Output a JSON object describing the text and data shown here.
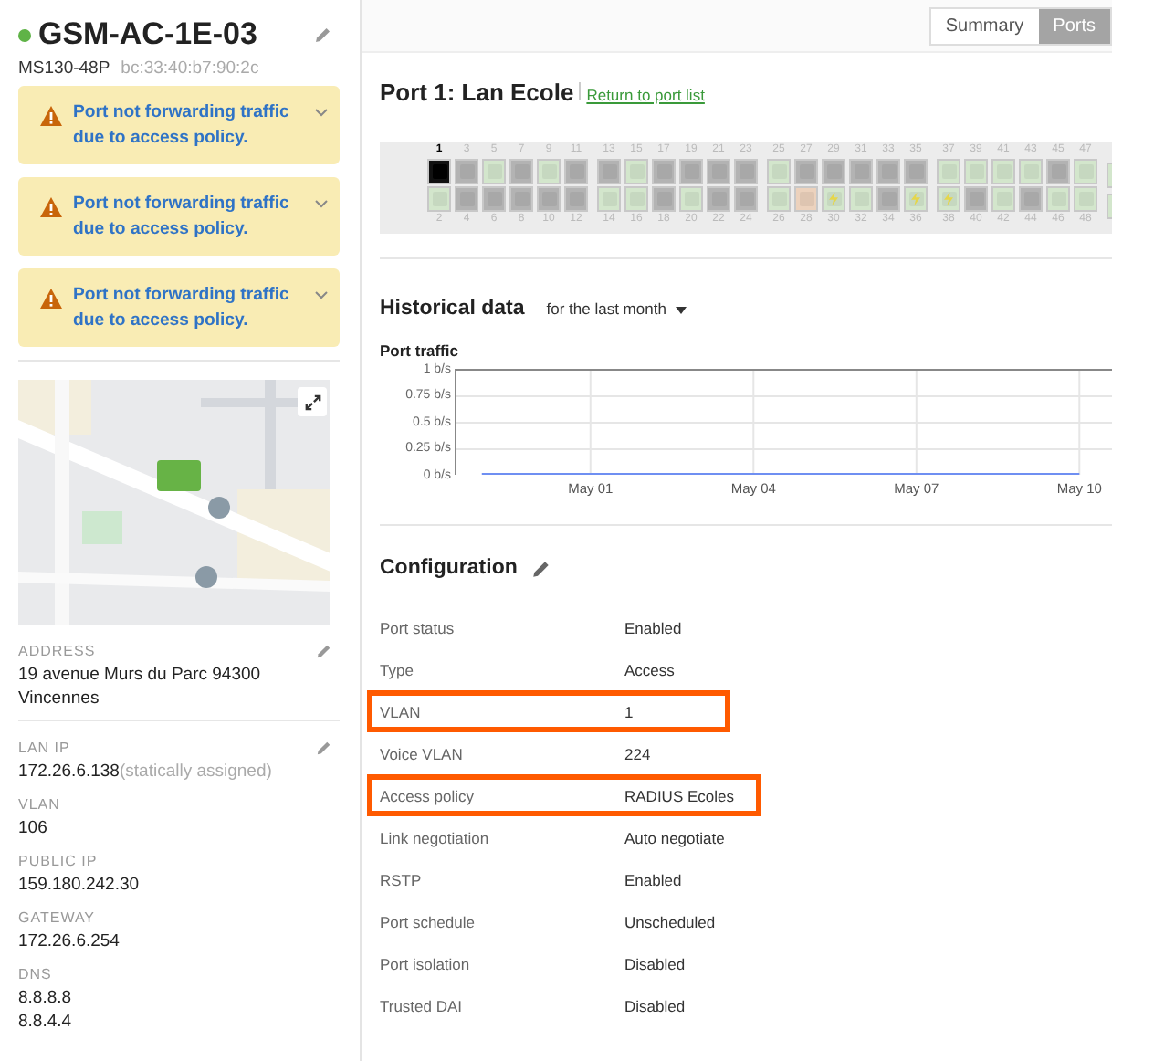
{
  "device": {
    "name": "GSM-AC-1E-03",
    "online": true,
    "model": "MS130-48P",
    "mac": "bc:33:40:b7:90:2c"
  },
  "alerts": [
    {
      "text": "Port not forwarding traffic due to access policy."
    },
    {
      "text": "Port not forwarding traffic due to access policy."
    },
    {
      "text": "Port not forwarding traffic due to access policy."
    }
  ],
  "address": {
    "label": "ADDRESS",
    "value": "19 avenue Murs du Parc 94300 Vincennes"
  },
  "details": [
    {
      "label": "LAN IP",
      "values": [
        "172.26.6.138"
      ],
      "note": "(statically assigned)",
      "editable": true
    },
    {
      "label": "VLAN",
      "values": [
        "106"
      ],
      "editable": false
    },
    {
      "label": "PUBLIC IP",
      "values": [
        "159.180.242.30"
      ],
      "editable": false
    },
    {
      "label": "GATEWAY",
      "values": [
        "172.26.6.254"
      ],
      "editable": false
    },
    {
      "label": "DNS",
      "values": [
        "8.8.8.8",
        "8.8.4.4"
      ],
      "editable": false
    }
  ],
  "tabs": [
    {
      "label": "Summary",
      "selected": false
    },
    {
      "label": "Ports",
      "selected": true
    }
  ],
  "port_title": "Port 1: Lan Ecole",
  "return_link": "Return to port list",
  "ports": [
    {
      "number": "1",
      "kind": "selected",
      "poe": false
    },
    {
      "number": "2",
      "kind": "connected",
      "poe": false
    },
    {
      "number": "3",
      "kind": "disconnected",
      "poe": false
    },
    {
      "number": "4",
      "kind": "disconnected",
      "poe": false
    },
    {
      "number": "5",
      "kind": "connected",
      "poe": false
    },
    {
      "number": "6",
      "kind": "disconnected",
      "poe": false
    },
    {
      "number": "7",
      "kind": "disconnected",
      "poe": false
    },
    {
      "number": "8",
      "kind": "disconnected",
      "poe": false
    },
    {
      "number": "9",
      "kind": "connected",
      "poe": false
    },
    {
      "number": "10",
      "kind": "disconnected",
      "poe": false
    },
    {
      "number": "11",
      "kind": "disconnected",
      "poe": false
    },
    {
      "number": "12",
      "kind": "disconnected",
      "poe": false
    },
    {
      "number": "13",
      "kind": "disconnected",
      "poe": false
    },
    {
      "number": "14",
      "kind": "connected",
      "poe": false
    },
    {
      "number": "15",
      "kind": "connected",
      "poe": false
    },
    {
      "number": "16",
      "kind": "connected",
      "poe": false
    },
    {
      "number": "17",
      "kind": "disconnected",
      "poe": false
    },
    {
      "number": "18",
      "kind": "disconnected",
      "poe": false
    },
    {
      "number": "19",
      "kind": "disconnected",
      "poe": false
    },
    {
      "number": "20",
      "kind": "connected",
      "poe": false
    },
    {
      "number": "21",
      "kind": "disconnected",
      "poe": false
    },
    {
      "number": "22",
      "kind": "disconnected",
      "poe": false
    },
    {
      "number": "23",
      "kind": "disconnected",
      "poe": false
    },
    {
      "number": "24",
      "kind": "disconnected",
      "poe": false
    },
    {
      "number": "25",
      "kind": "connected",
      "poe": false
    },
    {
      "number": "26",
      "kind": "connected",
      "poe": false
    },
    {
      "number": "27",
      "kind": "disconnected",
      "poe": false
    },
    {
      "number": "28",
      "kind": "warning",
      "poe": false
    },
    {
      "number": "29",
      "kind": "disconnected",
      "poe": false
    },
    {
      "number": "30",
      "kind": "connected",
      "poe": true
    },
    {
      "number": "31",
      "kind": "disconnected",
      "poe": false
    },
    {
      "number": "32",
      "kind": "connected",
      "poe": false
    },
    {
      "number": "33",
      "kind": "disconnected",
      "poe": false
    },
    {
      "number": "34",
      "kind": "disconnected",
      "poe": false
    },
    {
      "number": "35",
      "kind": "disconnected",
      "poe": false
    },
    {
      "number": "36",
      "kind": "connected",
      "poe": true
    },
    {
      "number": "37",
      "kind": "connected",
      "poe": false
    },
    {
      "number": "38",
      "kind": "connected",
      "poe": true
    },
    {
      "number": "39",
      "kind": "connected",
      "poe": false
    },
    {
      "number": "40",
      "kind": "disconnected",
      "poe": false
    },
    {
      "number": "41",
      "kind": "connected",
      "poe": false
    },
    {
      "number": "42",
      "kind": "connected",
      "poe": false
    },
    {
      "number": "43",
      "kind": "connected",
      "poe": false
    },
    {
      "number": "44",
      "kind": "disconnected",
      "poe": false
    },
    {
      "number": "45",
      "kind": "disconnected",
      "poe": false
    },
    {
      "number": "46",
      "kind": "connected",
      "poe": false
    },
    {
      "number": "47",
      "kind": "connected",
      "poe": false
    },
    {
      "number": "48",
      "kind": "connected",
      "poe": false
    }
  ],
  "uplinks": [
    {
      "kind": "connected"
    },
    {
      "kind": "connected"
    }
  ],
  "historical": {
    "title": "Historical data",
    "range": "for the last month"
  },
  "chart_data": {
    "type": "line",
    "title": "Port traffic",
    "categories": [
      null,
      null,
      "May 01",
      null,
      null,
      "May 04",
      null,
      null,
      "May 07",
      null,
      null,
      "May 10"
    ],
    "ylim": [
      0,
      1
    ],
    "grid": true,
    "yticks": [
      {
        "value": 0,
        "label": "0 b/s"
      },
      {
        "value": 0.25,
        "label": "0.25 b/s"
      },
      {
        "value": 0.5,
        "label": "0.5 b/s"
      },
      {
        "value": 0.75,
        "label": "0.75 b/s"
      },
      {
        "value": 1,
        "label": "1 b/s"
      }
    ],
    "series": [
      {
        "color": "#6f8ff2",
        "values": [
          0,
          0,
          0,
          0,
          0,
          0,
          0,
          0,
          0,
          0,
          0,
          0
        ]
      }
    ]
  },
  "configuration": {
    "title": "Configuration",
    "rows": [
      {
        "label": "Port status",
        "value": "Enabled",
        "highlighted": false
      },
      {
        "label": "Type",
        "value": "Access",
        "highlighted": false
      },
      {
        "label": "VLAN",
        "value": "1",
        "highlighted": true
      },
      {
        "label": "Voice VLAN",
        "value": "224",
        "highlighted": false
      },
      {
        "label": "Access policy",
        "value": "RADIUS Ecoles",
        "highlighted": true
      },
      {
        "label": "Link negotiation",
        "value": "Auto negotiate",
        "highlighted": false
      },
      {
        "label": "RSTP",
        "value": "Enabled",
        "highlighted": false
      },
      {
        "label": "Port schedule",
        "value": "Unscheduled",
        "highlighted": false
      },
      {
        "label": "Port isolation",
        "value": "Disabled",
        "highlighted": false
      },
      {
        "label": "Trusted DAI",
        "value": "Disabled",
        "highlighted": false
      }
    ]
  }
}
